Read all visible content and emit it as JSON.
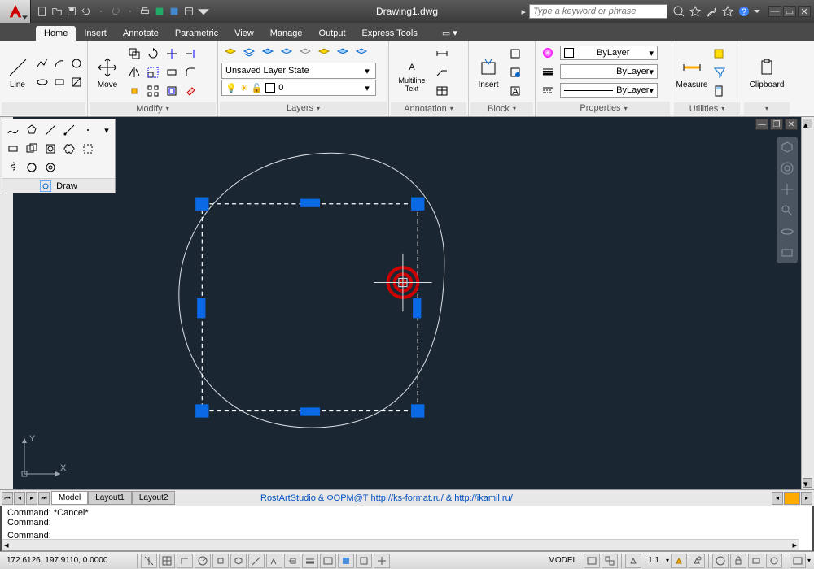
{
  "title": "Drawing1.dwg",
  "search_placeholder": "Type a keyword or phrase",
  "tabs": [
    "Home",
    "Insert",
    "Annotate",
    "Parametric",
    "View",
    "Manage",
    "Output",
    "Express Tools"
  ],
  "active_tab": 0,
  "ribbon": {
    "draw": {
      "title": "",
      "line_label": "Line"
    },
    "modify": {
      "title": "Modify",
      "move_label": "Move"
    },
    "layers": {
      "title": "Layers",
      "state": "Unsaved Layer State",
      "current": "0"
    },
    "annotation": {
      "title": "Annotation",
      "mtext_label": "Multiline\nText"
    },
    "block": {
      "title": "Block",
      "insert_label": "Insert"
    },
    "properties": {
      "title": "Properties",
      "color": "ByLayer",
      "ltype": "ByLayer",
      "lweight": "ByLayer"
    },
    "utilities": {
      "title": "Utilities",
      "measure_label": "Measure"
    },
    "clipboard": {
      "title": "",
      "clip_label": "Clipboard"
    }
  },
  "palette_title": "Draw",
  "layout_tabs": [
    "Model",
    "Layout1",
    "Layout2"
  ],
  "credits": "RostArtStudio & ФОРМ@Т http://ks-format.ru/ & http://ikamil.ru/",
  "cmd_lines": [
    "Command: *Cancel*",
    "Command:",
    "",
    "Command:"
  ],
  "status": {
    "coords": "172.6126, 197.9110, 0.0000",
    "model": "MODEL",
    "scale": "1:1"
  },
  "ucs": {
    "x": "X",
    "y": "Y"
  }
}
